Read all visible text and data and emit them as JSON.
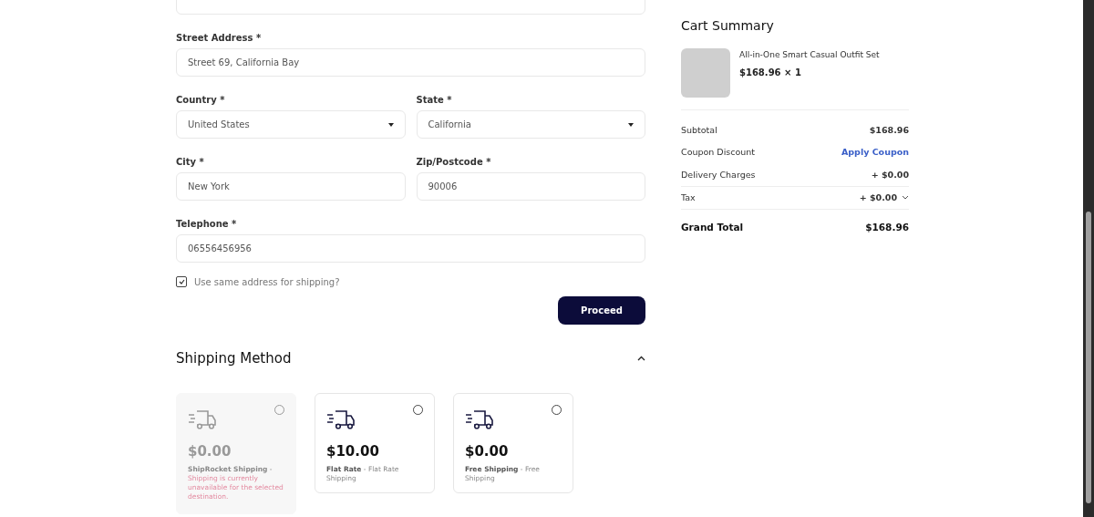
{
  "billing_form": {
    "field_rows": [
      [
        {
          "kind": "input",
          "label": "Street Address *",
          "value": "Street 69, California Bay"
        }
      ],
      [
        {
          "kind": "select",
          "label": "Country *",
          "value": "United States"
        },
        {
          "kind": "select",
          "label": "State *",
          "value": "California"
        }
      ],
      [
        {
          "kind": "input",
          "label": "City *",
          "value": "New York"
        },
        {
          "kind": "input",
          "label": "Zip/Postcode *",
          "value": "90006"
        }
      ],
      [
        {
          "kind": "input",
          "label": "Telephone *",
          "value": "06556456956"
        }
      ]
    ],
    "same_address": {
      "label": "Use same address for shipping?",
      "checked": true
    },
    "proceed_button": "Proceed"
  },
  "shipping_method": {
    "title": "Shipping Method",
    "expanded": true,
    "options": [
      {
        "price": "$0.00",
        "description": "**ShipRocket Shipping** -",
        "error": "Shipping is currently unavailable for the selected destination.",
        "disabled": true,
        "selected": false
      },
      {
        "price": "$10.00",
        "description": "**Flat Rate** - Flat Rate Shipping",
        "disabled": false,
        "selected": false
      },
      {
        "price": "$0.00",
        "description": "**Free Shipping** - Free Shipping",
        "disabled": false,
        "selected": false
      }
    ]
  },
  "cart_summary": {
    "title": "Cart Summary",
    "item": {
      "name": "All-in-One Smart Casual Outfit Set",
      "price": "$168.96 × 1"
    },
    "rows": [
      {
        "kind": "plain",
        "label": "Subtotal",
        "value": "$168.96"
      },
      {
        "kind": "link",
        "label": "Coupon Discount",
        "value": "Apply Coupon"
      },
      {
        "kind": "plain",
        "label": "Delivery Charges",
        "value": "+ $0.00"
      },
      {
        "kind": "expandable",
        "label": "Tax",
        "value": "+ $0.00",
        "expanded": false
      },
      {
        "kind": "total",
        "label": "Grand Total",
        "value": "$168.96"
      }
    ]
  }
}
